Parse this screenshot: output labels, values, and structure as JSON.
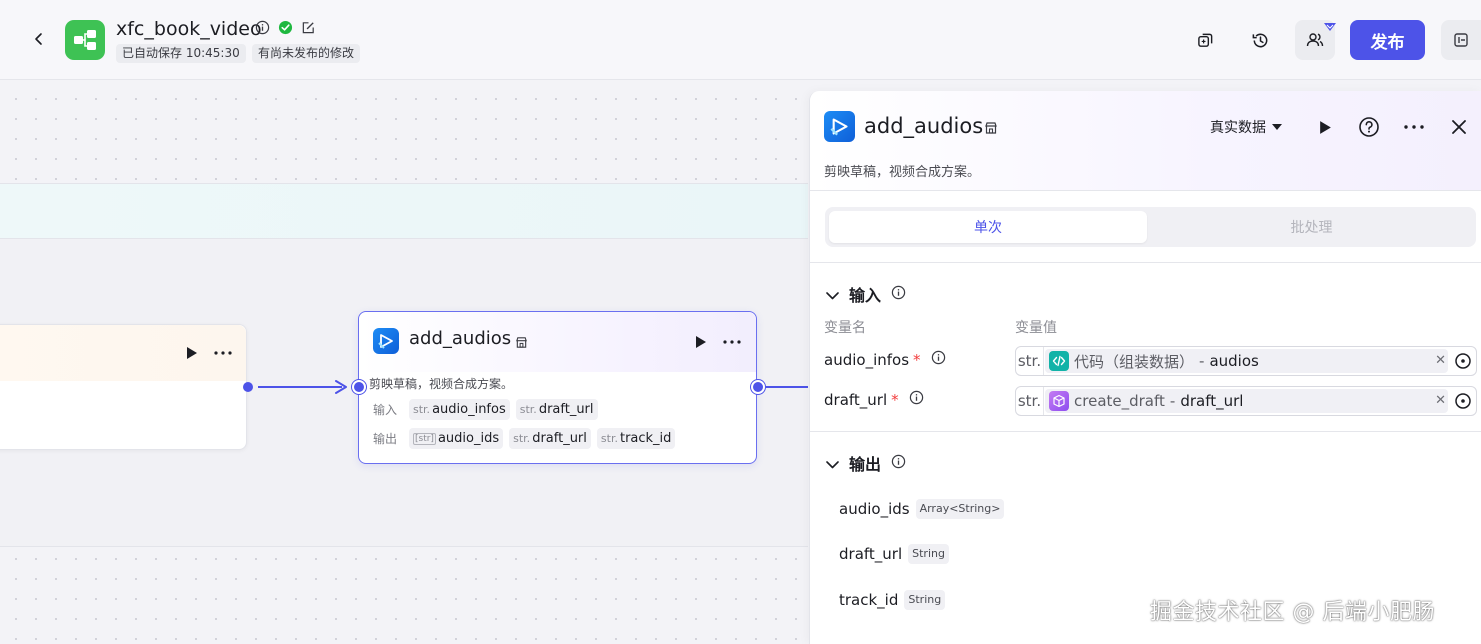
{
  "header": {
    "app_name": "xfc_book_video",
    "autosave_tag": "已自动保存 10:45:30",
    "unpublished_tag": "有尚未发布的修改",
    "publish_label": "发布",
    "icons": [
      "back-icon",
      "app-icon",
      "info-icon",
      "check-circle-icon",
      "edit-icon",
      "copy-icon",
      "history-icon",
      "collaborators-icon",
      "panel-icon"
    ]
  },
  "canvas": {
    "main_node": {
      "title": "add_audios",
      "description": "剪映草稿，视频合成方案。",
      "input_label": "输入",
      "output_label": "输出",
      "inputs": [
        {
          "type": "str.",
          "name": "audio_infos"
        },
        {
          "type": "str.",
          "name": "draft_url"
        }
      ],
      "outputs": [
        {
          "type": "[str]",
          "name": "audio_ids"
        },
        {
          "type": "str.",
          "name": "draft_url"
        },
        {
          "type": "str.",
          "name": "track_id"
        }
      ]
    }
  },
  "panel": {
    "title": "add_audios",
    "description": "剪映草稿，视频合成方案。",
    "mode": "真实数据",
    "tabs": [
      "单次",
      "批处理"
    ],
    "input_section": "输入",
    "col_name": "变量名",
    "col_value": "变量值",
    "inputs": [
      {
        "name": "audio_infos",
        "required": "*",
        "type": "str.",
        "source": "代码（组装数据）",
        "sep": "-",
        "field": "audios"
      },
      {
        "name": "draft_url",
        "required": "*",
        "type": "str.",
        "source": "create_draft",
        "sep": "-",
        "field": "draft_url"
      }
    ],
    "output_section": "输出",
    "outputs": [
      {
        "name": "audio_ids",
        "type": "Array<String>"
      },
      {
        "name": "draft_url",
        "type": "String"
      },
      {
        "name": "track_id",
        "type": "String"
      }
    ]
  },
  "watermark": "掘金技术社区 @ 后端小肥肠",
  "colors": {
    "accent": "#4d53e8",
    "app_icon": "#3ec254",
    "success": "#1fb840",
    "required": "#f23d3d"
  }
}
